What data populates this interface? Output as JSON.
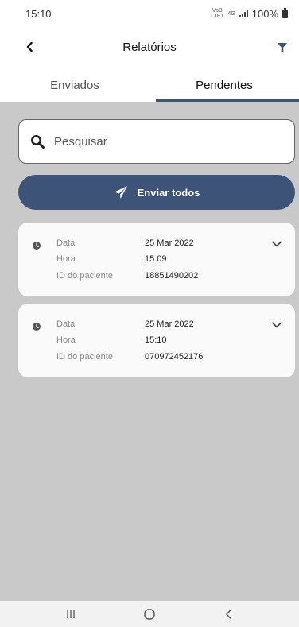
{
  "status_bar": {
    "time": "15:10",
    "network_top": "VoB",
    "network_bottom": "LTE1",
    "network_type": "4G",
    "battery": "100%"
  },
  "header": {
    "title": "Relatórios",
    "back_icon": "chevron-left-icon",
    "filter_icon": "filter-icon"
  },
  "tabs": [
    {
      "label": "Enviados",
      "active": false
    },
    {
      "label": "Pendentes",
      "active": true
    }
  ],
  "search": {
    "placeholder": "Pesquisar",
    "value": "",
    "icon": "search-icon"
  },
  "send_all": {
    "label": "Enviar todos",
    "icon": "paper-plane-icon"
  },
  "reports": [
    {
      "data_label": "Data",
      "data_value": "25 Mar 2022",
      "hora_label": "Hora",
      "hora_value": "15:09",
      "id_label": "ID do paciente",
      "id_value": "18851490202"
    },
    {
      "data_label": "Data",
      "data_value": "25 Mar 2022",
      "hora_label": "Hora",
      "hora_value": "15:10",
      "id_label": "ID do paciente",
      "id_value": "070972452176"
    }
  ],
  "colors": {
    "accent": "#3e5378",
    "content_background": "#c9c9c9",
    "card_background": "#fafafa"
  },
  "nav": {
    "recents_icon": "recents-icon",
    "home_icon": "home-icon",
    "back_icon": "back-icon"
  }
}
